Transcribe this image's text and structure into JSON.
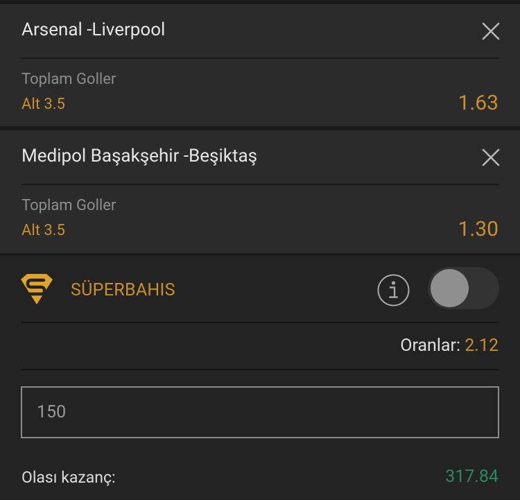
{
  "bets": [
    {
      "match": "Arsenal -Liverpool",
      "market": "Toplam Goller",
      "selection": "Alt 3.5",
      "odds": "1.63"
    },
    {
      "match": "Medipol Başakşehir -Beşiktaş",
      "market": "Toplam Goller",
      "selection": "Alt 3.5",
      "odds": "1.30"
    }
  ],
  "superbahis": {
    "label": "SÜPERBAHIS",
    "logo_letter": "S",
    "toggle_on": false
  },
  "summary": {
    "odds_label": "Oranlar:",
    "odds_value": "2.12",
    "stake_value": "150",
    "win_label": "Olası kazanç:",
    "win_value": "317.84"
  },
  "colors": {
    "accent": "#c9902a",
    "win": "#2a8a60",
    "card_bg": "#2b2b2b",
    "page_bg": "#1a1a1a"
  }
}
